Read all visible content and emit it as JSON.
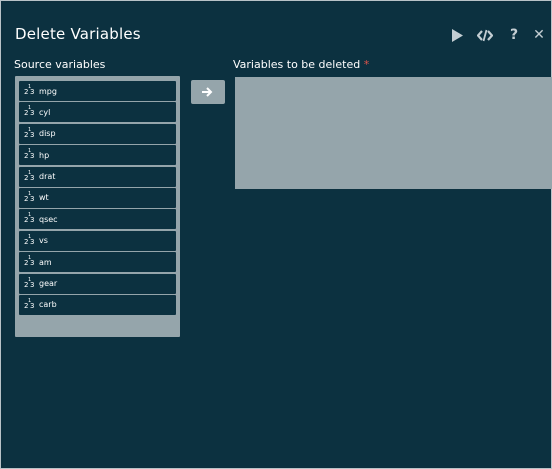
{
  "dialog": {
    "title": "Delete Variables",
    "icons": {
      "run": "play-icon",
      "syntax": "code-icon",
      "help": "question-icon",
      "close": "close-icon"
    },
    "help_symbol": "?",
    "close_symbol": "✕"
  },
  "source": {
    "label": "Source variables",
    "items": [
      {
        "name": "mpg"
      },
      {
        "name": "cyl"
      },
      {
        "name": "disp"
      },
      {
        "name": "hp"
      },
      {
        "name": "drat"
      },
      {
        "name": "wt"
      },
      {
        "name": "qsec"
      },
      {
        "name": "vs"
      },
      {
        "name": "am"
      },
      {
        "name": "gear"
      },
      {
        "name": "carb"
      }
    ]
  },
  "target": {
    "label": "Variables to be deleted",
    "required_mark": "*"
  },
  "colors": {
    "background": "#0c3140",
    "box": "#95a5ab",
    "required": "#e0534b"
  }
}
